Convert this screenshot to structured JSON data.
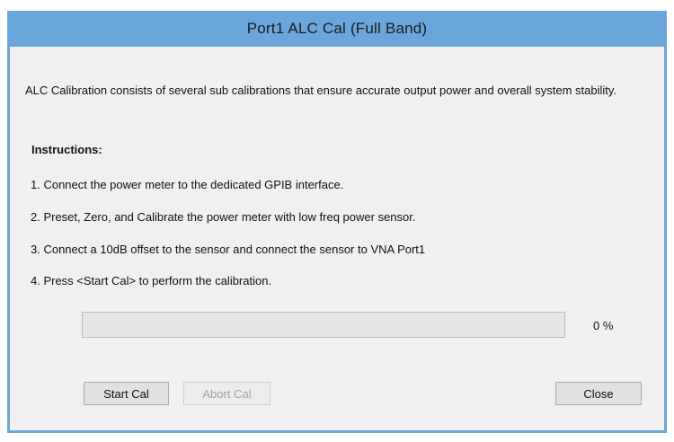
{
  "window": {
    "title": "Port1 ALC Cal (Full Band)"
  },
  "description": "ALC Calibration consists of several sub calibrations that ensure accurate output power and overall system stability.",
  "instructions": {
    "heading": "Instructions:",
    "steps": [
      "1.  Connect the power meter to the dedicated GPIB interface.",
      "2.  Preset, Zero, and Calibrate the power meter with low freq power sensor.",
      "3.  Connect a 10dB offset to the sensor and connect the sensor to VNA Port1",
      "4.  Press <Start Cal> to perform the calibration."
    ]
  },
  "progress": {
    "value": 0,
    "label": "0 %"
  },
  "buttons": {
    "start": "Start Cal",
    "abort": "Abort Cal",
    "close": "Close"
  },
  "colors": {
    "titlebar": "#6aa6da",
    "client": "#f0f0f0"
  }
}
